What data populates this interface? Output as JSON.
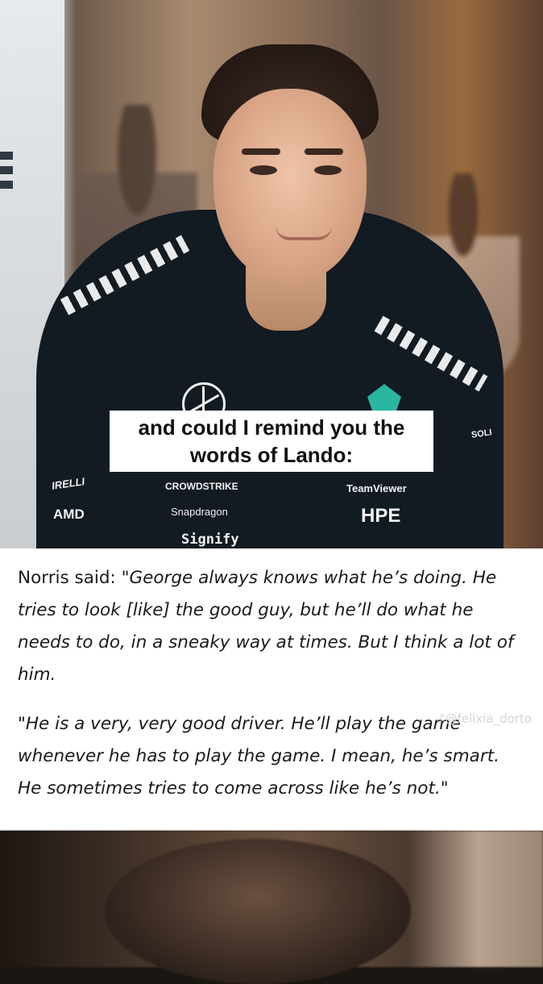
{
  "caption": {
    "line1": "and could I remind you the",
    "line2": "words of Lando:"
  },
  "sponsors": {
    "crowdstrike": "CROWDSTRIKE",
    "teamviewer": "TeamViewer",
    "snapdragon": "Snapdragon",
    "hpe": "HPE",
    "signify": "Signify",
    "amd": "AMD",
    "pirelli": "IRELLI",
    "soli": "SOLI"
  },
  "quote": {
    "paragraph1_plain": "Norris said: \"",
    "paragraph1_italic": "George always knows what he’s doing. He tries to look [like] the good guy, but he’ll do what he needs to do, in a sneaky way at times. But I think a lot of him.",
    "paragraph2_italic": "\"He is a very, very good driver. He’ll play the game whenever he has to play the game. I mean, he’s smart. He sometimes tries to come across like he’s not.\"",
    "watermark": "♪@felixia_dorto"
  },
  "colors": {
    "caption_bg": "#ffffff",
    "quote_bg": "#ffffff",
    "text": "#1a1a1a",
    "hoodie": "#121a22",
    "petronas_teal": "#2ab7a0"
  }
}
